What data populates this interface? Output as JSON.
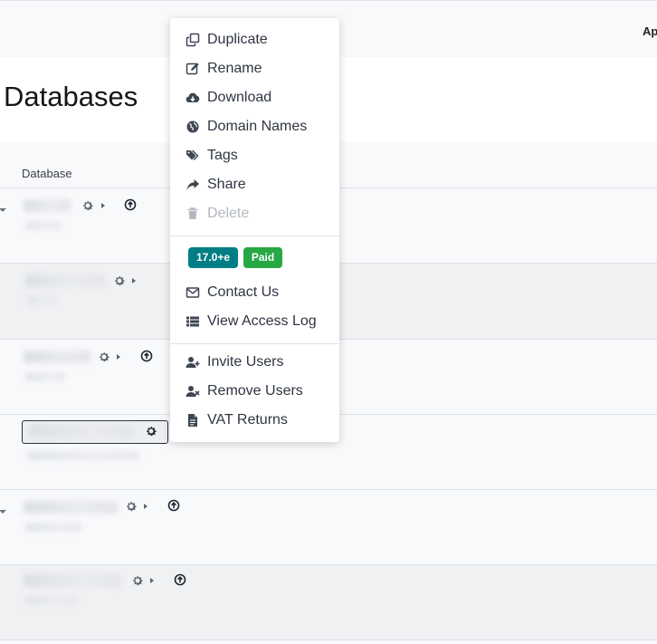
{
  "header": {
    "right_text": "Ap"
  },
  "page": {
    "title": "Databases"
  },
  "table": {
    "column_header": "Database"
  },
  "menu": {
    "items": [
      {
        "label": "Duplicate",
        "icon": "duplicate-icon",
        "disabled": false
      },
      {
        "label": "Rename",
        "icon": "edit-icon",
        "disabled": false
      },
      {
        "label": "Download",
        "icon": "cloud-download-icon",
        "disabled": false
      },
      {
        "label": "Domain Names",
        "icon": "globe-icon",
        "disabled": false
      },
      {
        "label": "Tags",
        "icon": "tags-icon",
        "disabled": false
      },
      {
        "label": "Share",
        "icon": "share-icon",
        "disabled": false
      },
      {
        "label": "Delete",
        "icon": "trash-icon",
        "disabled": true
      }
    ],
    "version_badge": {
      "text": "17.0+e",
      "color": "#017e84"
    },
    "status_badge": {
      "text": "Paid",
      "color": "#28a745"
    },
    "support_items": [
      {
        "label": "Contact Us",
        "icon": "envelope-icon"
      },
      {
        "label": "View Access Log",
        "icon": "list-icon"
      }
    ],
    "user_items": [
      {
        "label": "Invite Users",
        "icon": "user-plus-icon"
      },
      {
        "label": "Remove Users",
        "icon": "user-times-icon"
      },
      {
        "label": "VAT Returns",
        "icon": "file-icon"
      }
    ]
  },
  "colors": {
    "text": "#2f3542",
    "disabled": "#b3b8c0",
    "background": "#f8f9fb"
  }
}
